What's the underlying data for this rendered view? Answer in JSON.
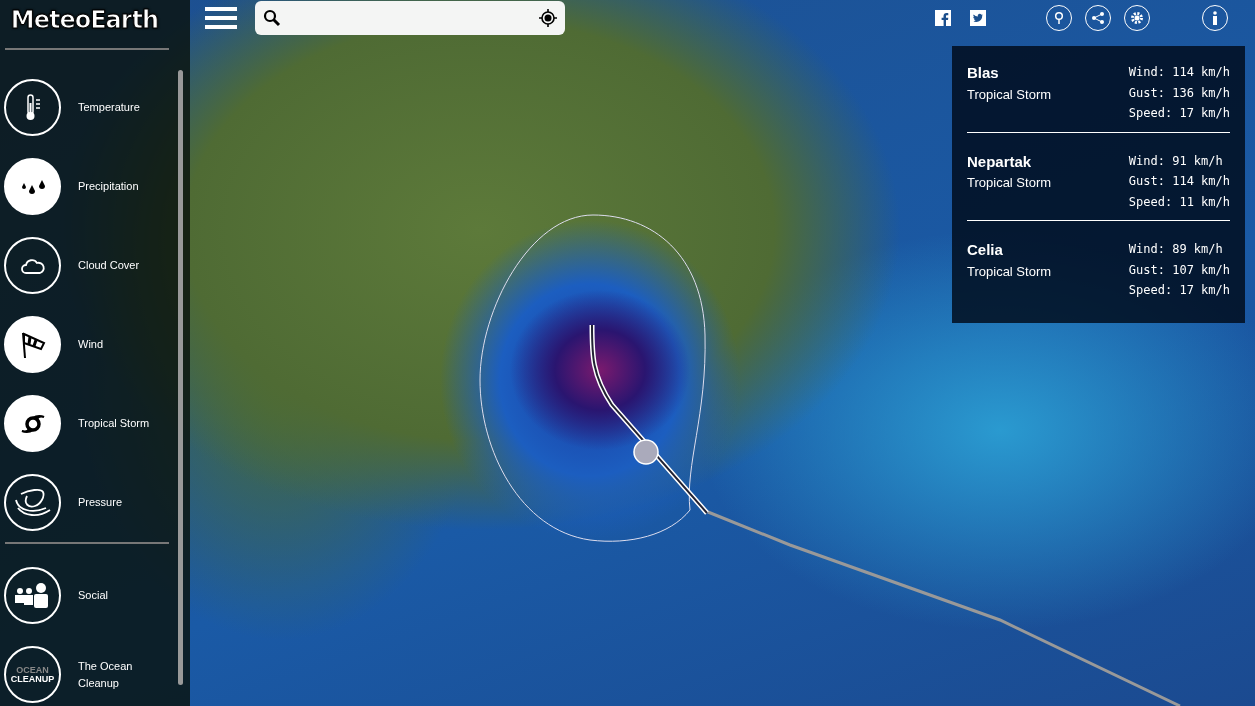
{
  "logo": "MeteoEarth",
  "layers": [
    {
      "kind": "temperature",
      "label": "Temperature",
      "selected": false
    },
    {
      "kind": "precipitation",
      "label": "Precipitation",
      "selected": true
    },
    {
      "kind": "cloud",
      "label": "Cloud Cover",
      "selected": false
    },
    {
      "kind": "wind",
      "label": "Wind",
      "selected": true
    },
    {
      "kind": "storm",
      "label": "Tropical Storm",
      "selected": true
    },
    {
      "kind": "pressure",
      "label": "Pressure",
      "selected": false
    }
  ],
  "extras": [
    {
      "kind": "social",
      "label": "Social"
    },
    {
      "kind": "ocean",
      "label": "The Ocean Cleanup",
      "icon_text": [
        "OCEAN",
        "CLEANUP"
      ]
    }
  ],
  "storms": [
    {
      "name": "Blas",
      "type": "Tropical Storm",
      "stats": [
        "Wind: 114 km/h",
        "Gust: 136 km/h",
        "Speed: 17 km/h"
      ]
    },
    {
      "name": "Nepartak",
      "type": "Tropical Storm",
      "stats": [
        "Wind: 91 km/h",
        "Gust: 114 km/h",
        "Speed: 11 km/h"
      ]
    },
    {
      "name": "Celia",
      "type": "Tropical Storm",
      "stats": [
        "Wind: 89 km/h",
        "Gust: 107 km/h",
        "Speed: 17 km/h"
      ]
    }
  ]
}
